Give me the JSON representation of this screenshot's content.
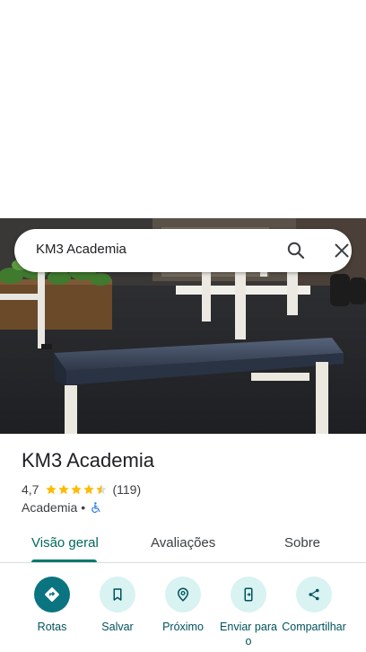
{
  "search": {
    "query": "KM3 Academia"
  },
  "place": {
    "name": "KM3 Academia",
    "rating": "4,7",
    "stars_filled": 4.5,
    "review_count": "(119)",
    "category": "Academia",
    "separator": "•",
    "accessibility_icon": "wheelchair-icon"
  },
  "tabs": [
    {
      "label": "Visão geral",
      "active": true
    },
    {
      "label": "Avaliações",
      "active": false
    },
    {
      "label": "Sobre",
      "active": false
    }
  ],
  "actions": [
    {
      "label": "Rotas",
      "icon": "directions-icon"
    },
    {
      "label": "Salvar",
      "icon": "bookmark-icon"
    },
    {
      "label": "Próximo",
      "icon": "nearby-icon"
    },
    {
      "label": "Enviar para o",
      "icon": "send-to-phone-icon"
    },
    {
      "label": "Compartilhar",
      "icon": "share-icon"
    }
  ],
  "colors": {
    "accent": "#00796b",
    "action_bg": "#d9f2f2",
    "primary_action": "#0a7480",
    "star": "#fbbc04"
  }
}
